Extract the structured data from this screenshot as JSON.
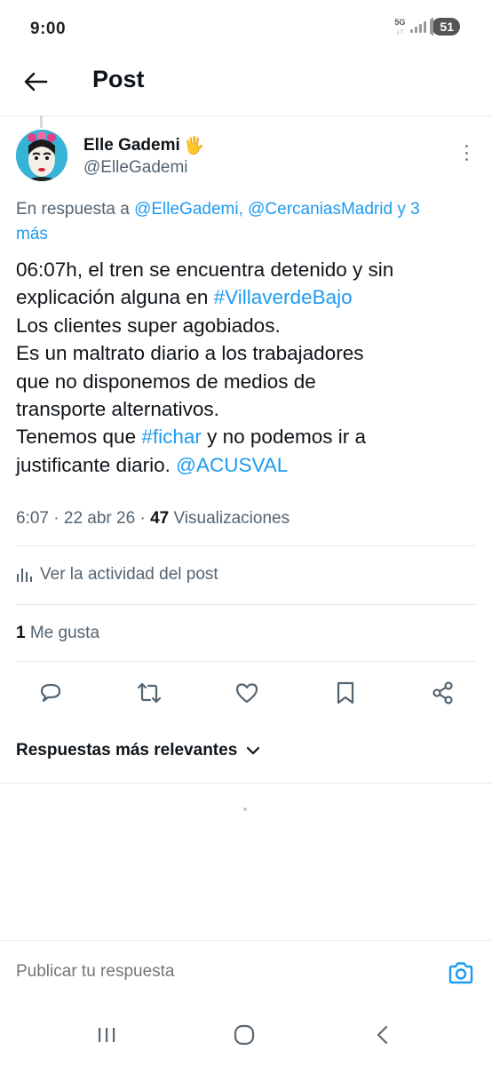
{
  "status_bar": {
    "time": "9:00",
    "network": "5G",
    "battery": "51"
  },
  "header": {
    "title": "Post"
  },
  "post": {
    "author": {
      "name": "Elle Gademi",
      "emoji": "🖐",
      "handle": "@ElleGademi"
    },
    "reply_to": {
      "prefix": "En respuesta a ",
      "mentions": "@ElleGademi, @CercaniasMadrid y 3",
      "suffix": "más"
    },
    "body": {
      "l1": "06:07h, el tren se encuentra detenido y sin",
      "l2a": "explicación alguna en ",
      "l2_hashtag": "#VillaverdeBajo",
      "l3": "Los clientes super agobiados.",
      "l4": "Es un maltrato diario a los trabajadores",
      "l5": "que no disponemos de medios de",
      "l6": "transporte alternativos.",
      "l7a": "Tenemos que ",
      "l7_hashtag": "#fichar",
      "l7b": " y no podemos ir a",
      "l8a": "justificante diario. ",
      "l8_mention": "@ACUSVAL"
    },
    "meta": {
      "time": "6:07",
      "sep": " · ",
      "date": "22 abr 26",
      "views_count": "47",
      "views_label": " Visualizaciones"
    },
    "activity_label": "Ver la actividad del post",
    "likes": {
      "count": "1",
      "label": " Me gusta"
    }
  },
  "replies": {
    "sort_label": "Respuestas más relevantes"
  },
  "composer": {
    "placeholder": "Publicar tu respuesta"
  },
  "colors": {
    "link": "#1d9bf0",
    "text": "#0f1419",
    "muted": "#536471"
  },
  "icons": [
    "back-arrow-icon",
    "more-vertical-icon",
    "bar-chart-icon",
    "reply-icon",
    "repost-icon",
    "like-icon",
    "bookmark-icon",
    "share-icon",
    "chevron-down-icon",
    "camera-icon",
    "recents-icon",
    "home-icon",
    "back-icon"
  ]
}
